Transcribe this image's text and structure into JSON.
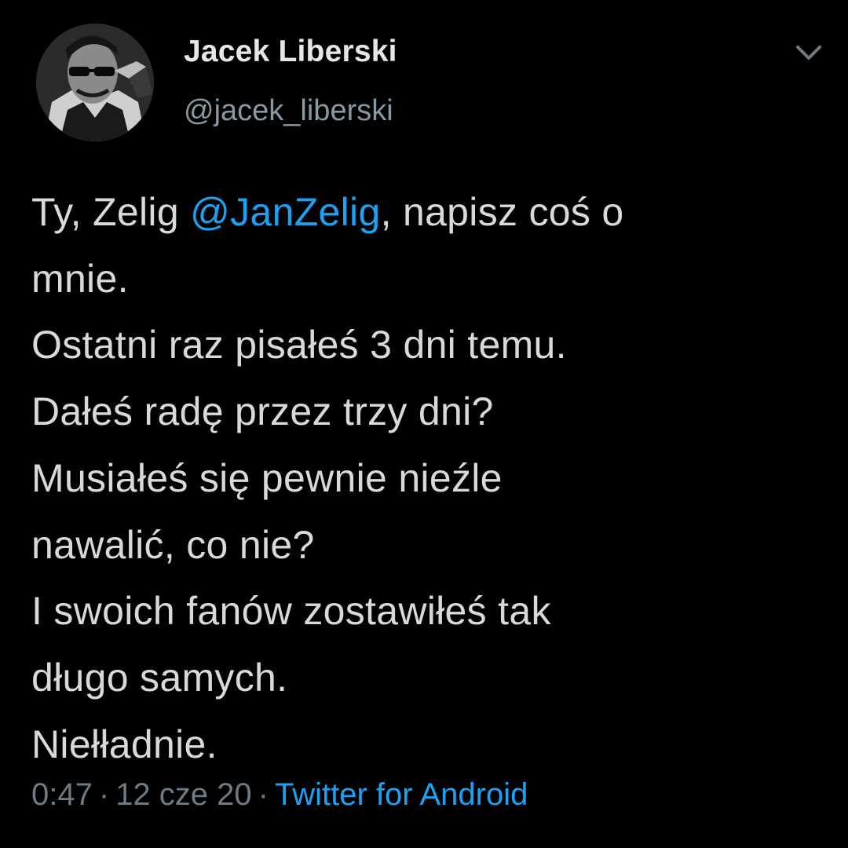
{
  "author": {
    "display_name": "Jacek Liberski",
    "handle": "@jacek_liberski"
  },
  "tweet": {
    "lines": [
      {
        "before": "Ty, Zelig ",
        "mention": "@JanZelig",
        "after": ", napisz coś o"
      },
      {
        "text": "mnie."
      },
      {
        "text": "Ostatni raz pisałeś 3 dni temu."
      },
      {
        "text": "Dałeś radę przez trzy dni?"
      },
      {
        "text": "Musiałeś się pewnie nieźle"
      },
      {
        "text": "nawalić, co nie?"
      },
      {
        "text": "I swoich fanów zostawiłeś tak"
      },
      {
        "text": "długo samych."
      },
      {
        "text": "Niełładnie."
      }
    ]
  },
  "meta": {
    "time": "0:47",
    "separator": "·",
    "date": "12 cze 20",
    "source": "Twitter for Android"
  },
  "icons": {
    "menu": "chevron-down-icon",
    "avatar": "profile-photo"
  },
  "colors": {
    "background": "#000000",
    "text": "#D9D9D9",
    "secondary": "#8899A6",
    "accent": "#1DA1F2"
  }
}
